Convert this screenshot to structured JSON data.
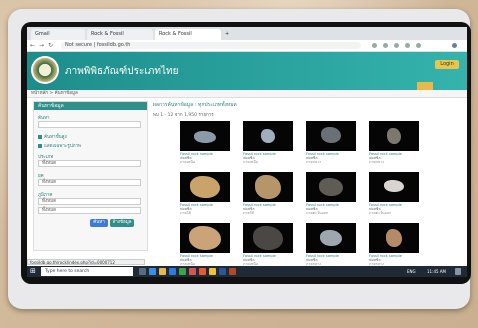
{
  "browser": {
    "tabs": [
      {
        "label": "Gmail",
        "active": false
      },
      {
        "label": "Rock & Fossil",
        "active": false
      },
      {
        "label": "Rock & Fossil",
        "active": true
      }
    ],
    "new_tab_symbol": "+",
    "back_icon": "arrow-left-icon",
    "forward_icon": "arrow-right-icon",
    "reload_icon": "reload-icon",
    "address": "Not secure | fossildb.go.th"
  },
  "site": {
    "title": "ภาพพิพิธภัณฑ์ประเภทไทย",
    "login_label": "Login",
    "header_color": "#2f8f8a",
    "breadcrumb": "หน้าหลัก > ค้นหาข้อมูล"
  },
  "filter": {
    "heading": "ค้นหาข้อมูล",
    "keyword_label": "ค้นหา",
    "keyword_value": "",
    "checks": [
      "ค้นหาขั้นสูง",
      "แสดงเฉพาะรูปภาพ"
    ],
    "type_label": "ประเภท",
    "type_value": "ทั้งหมด",
    "period_label": "ยุค",
    "period_value": "ทั้งหมด",
    "region_label": "ภูมิภาค",
    "region_values": [
      "ทั้งหมด",
      "ทั้งหมด"
    ],
    "search_button": "ค้นหา",
    "reset_button": "ล้างข้อมูล"
  },
  "results": {
    "title": "ผลการค้นหาข้อมูล : ทุกประเภททั้งหมด",
    "subtitle": "พบ 1 - 12 จาก 1,950 รายการ",
    "items": [
      {
        "name": "Fossil rock sample",
        "sub": "ฟอสซิล",
        "meta": "ภาคเหนือ"
      },
      {
        "name": "Fossil rock sample",
        "sub": "ฟอสซิล",
        "meta": "ภาคเหนือ"
      },
      {
        "name": "Fossil rock sample",
        "sub": "ฟอสซิล",
        "meta": "ภาคกลาง"
      },
      {
        "name": "Fossil rock sample",
        "sub": "ฟอสซิล",
        "meta": "ภาคกลาง"
      },
      {
        "name": "Fossil rock sample",
        "sub": "ฟอสซิล",
        "meta": "ภาคใต้"
      },
      {
        "name": "Fossil rock sample",
        "sub": "ฟอสซิล",
        "meta": "ภาคใต้"
      },
      {
        "name": "Fossil rock sample",
        "sub": "ฟอสซิล",
        "meta": "ภาคตะวันออก"
      },
      {
        "name": "Fossil rock sample",
        "sub": "ฟอสซิล",
        "meta": "ภาคตะวันออก"
      },
      {
        "name": "Fossil rock sample",
        "sub": "ฟอสซิล",
        "meta": "ภาคเหนือ"
      },
      {
        "name": "Fossil rock sample",
        "sub": "ฟอสซิล",
        "meta": "ภาคเหนือ"
      },
      {
        "name": "Fossil rock sample",
        "sub": "ฟอสซิล",
        "meta": "ภาคกลาง"
      },
      {
        "name": "Fossil rock sample",
        "sub": "ฟอสซิล",
        "meta": "ภาคกลาง"
      }
    ],
    "rock_colors": [
      "#8a9aa6",
      "#9fb0bd",
      "#6b7076",
      "#7d776e",
      "#c9a36a",
      "#b7956b",
      "#5f5b55",
      "#d8d4cf",
      "#caa478",
      "#4a4744",
      "#9ea7ae",
      "#b68a66"
    ]
  },
  "status_url": "fossildb.go.th/rock/index.php?id=0000712",
  "taskbar": {
    "start_symbol": "⊞",
    "search_placeholder": "Type here to search",
    "tray_text": "ENG",
    "clock": "11:45 AM"
  }
}
